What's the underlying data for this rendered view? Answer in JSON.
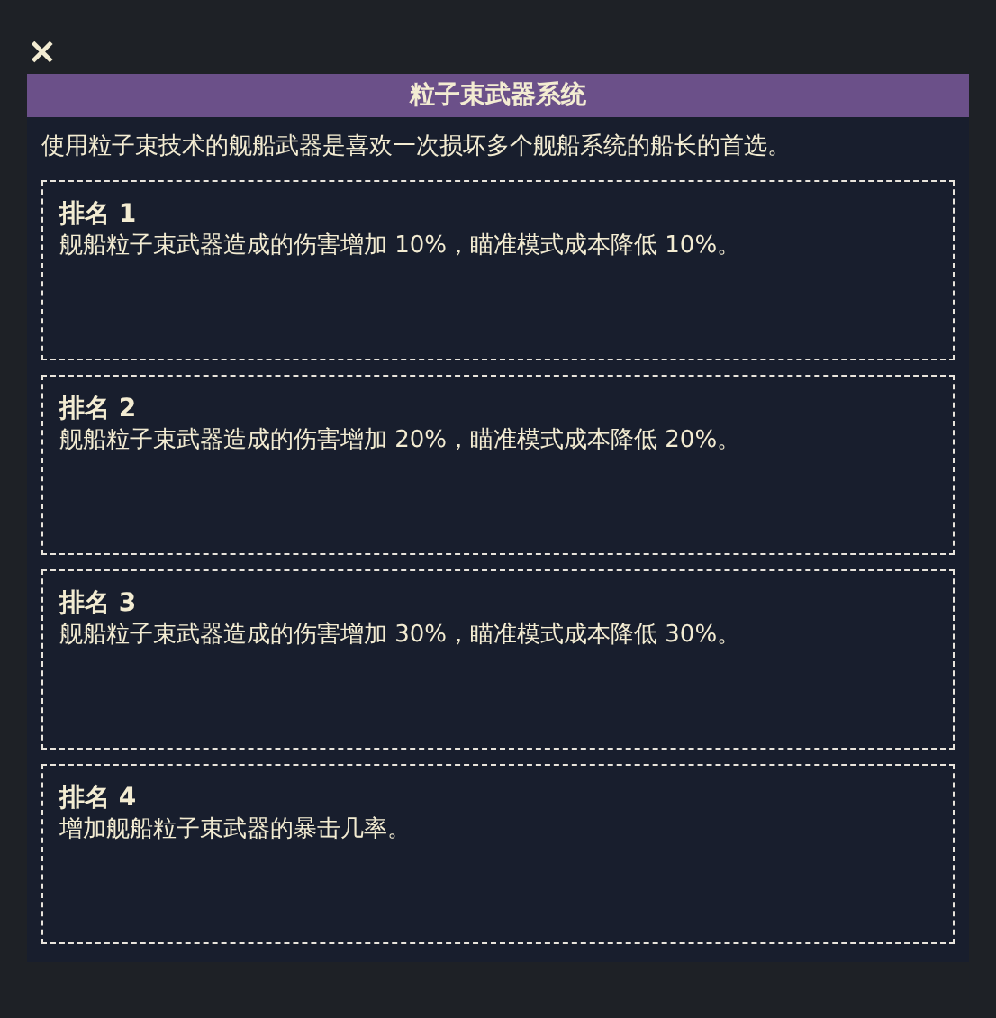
{
  "close_button": "×",
  "panel": {
    "title": "粒子束武器系统",
    "description": "使用粒子束技术的舰船武器是喜欢一次损坏多个舰船系统的船长的首选。",
    "ranks": [
      {
        "title": "排名 1",
        "text": "舰船粒子束武器造成的伤害增加 10%，瞄准模式成本降低 10%。"
      },
      {
        "title": "排名 2",
        "text": "舰船粒子束武器造成的伤害增加 20%，瞄准模式成本降低 20%。"
      },
      {
        "title": "排名 3",
        "text": "舰船粒子束武器造成的伤害增加 30%，瞄准模式成本降低 30%。"
      },
      {
        "title": "排名 4",
        "text": "增加舰船粒子束武器的暴击几率。"
      }
    ]
  }
}
